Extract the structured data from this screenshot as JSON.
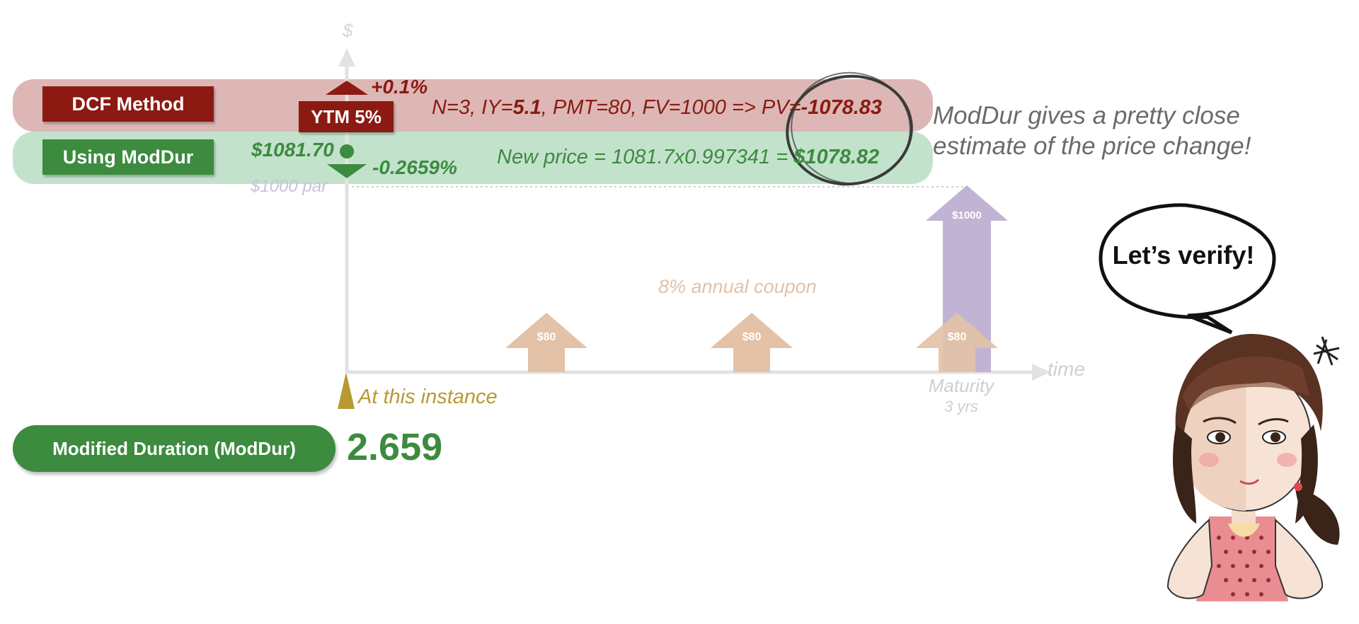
{
  "labels": {
    "dcf_method": "DCF Method",
    "using_moddur": "Using ModDur",
    "ytm": "YTM 5%",
    "yield_up": "+0.1%",
    "price_change": "-0.2659%",
    "initial_price": "$1081.70",
    "par": "$1000 par",
    "dollar_axis": "$",
    "time_axis": "time",
    "maturity": "Maturity",
    "maturity_term": "3 yrs",
    "instance": "At this instance",
    "coupon_note": "8% annual coupon"
  },
  "dcf": {
    "prefix": "N=3, IY=",
    "iy": "5.1",
    "middle": ", PMT=80, FV=1000 => PV=",
    "pv": "-1078.83"
  },
  "moddur_calc": {
    "prefix": "New price = 1081.7x0.997341 = ",
    "result": "$1078.82"
  },
  "cash_flows": [
    {
      "label": "$80"
    },
    {
      "label": "$80"
    },
    {
      "label": "$80"
    }
  ],
  "face_value_flow": {
    "label": "$1000"
  },
  "modified_duration": {
    "label": "Modified Duration (ModDur)",
    "value": "2.659"
  },
  "note": {
    "line1": "ModDur gives a pretty close",
    "line2": "estimate of the price change!"
  },
  "speech_bubble": "Let’s verify!",
  "colors": {
    "dcf_dark": "#8b1a12",
    "dcf_band": "#dcb7b5",
    "moddur_green": "#3c8b3f",
    "moddur_band": "#c3e2cc",
    "coupon_arrow": "#e3c2a7",
    "face_arrow": "#c0b3d3",
    "instance_marker": "#b89a32"
  }
}
